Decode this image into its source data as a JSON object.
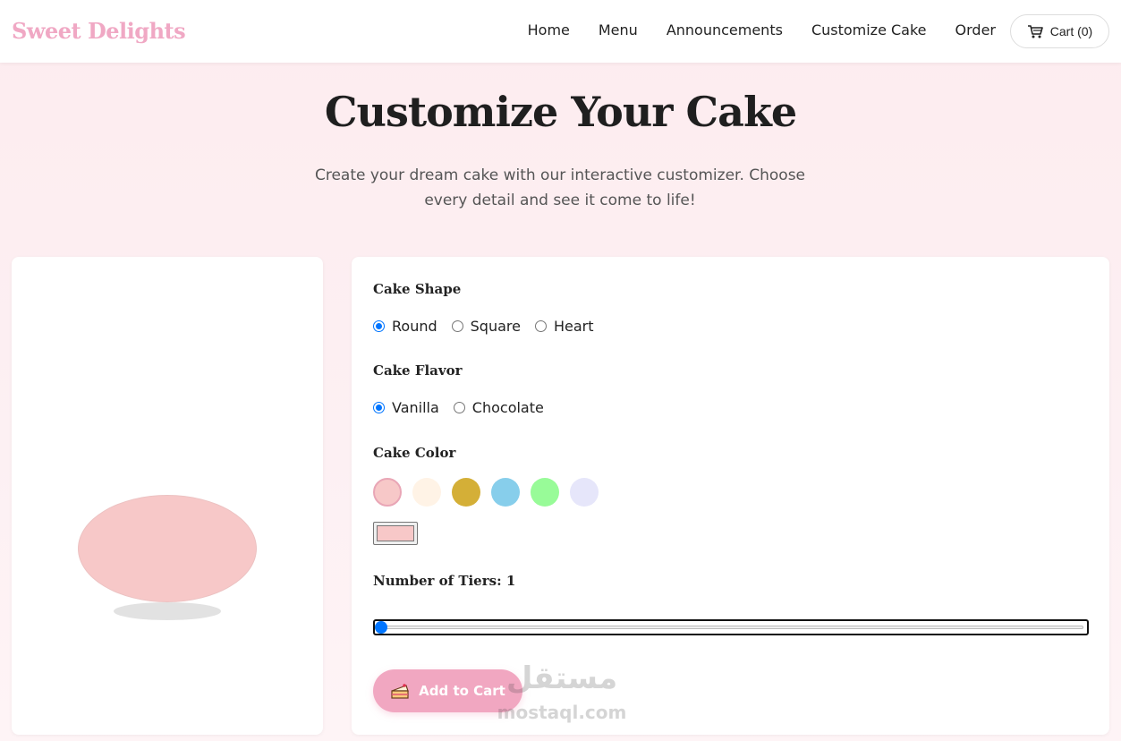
{
  "brand": {
    "name": "Sweet Delights",
    "color": "#f0a8c4"
  },
  "nav": {
    "links": [
      "Home",
      "Menu",
      "Announcements",
      "Customize Cake",
      "Order"
    ],
    "cart_label": "Cart (0)",
    "cart_icon": "cart-icon"
  },
  "hero": {
    "title": "Customize Your Cake",
    "subtitle": "Create your dream cake with our interactive customizer. Choose every detail and see it come to life!"
  },
  "preview": {
    "cake_color": "#f7c8c8",
    "shape": "Round"
  },
  "options": {
    "shape": {
      "label": "Cake Shape",
      "choices": [
        "Round",
        "Square",
        "Heart"
      ],
      "selected": "Round"
    },
    "flavor": {
      "label": "Cake Flavor",
      "choices": [
        "Vanilla",
        "Chocolate"
      ],
      "selected": "Vanilla"
    },
    "color": {
      "label": "Cake Color",
      "swatches": [
        "#f7c8c8",
        "#fff3e6",
        "#d4af37",
        "#87ceeb",
        "#98fb98",
        "#e6e6fa"
      ],
      "selected": "#f7c8c8",
      "picker_value": "#f7c8c8"
    },
    "tiers": {
      "label": "Number of Tiers: 1",
      "value": 1
    },
    "add_to_cart": {
      "label": "Add to Cart",
      "icon": "cake-slice-icon"
    }
  },
  "watermark": {
    "arabic": "مستقل",
    "latin": "mostaql.com"
  }
}
